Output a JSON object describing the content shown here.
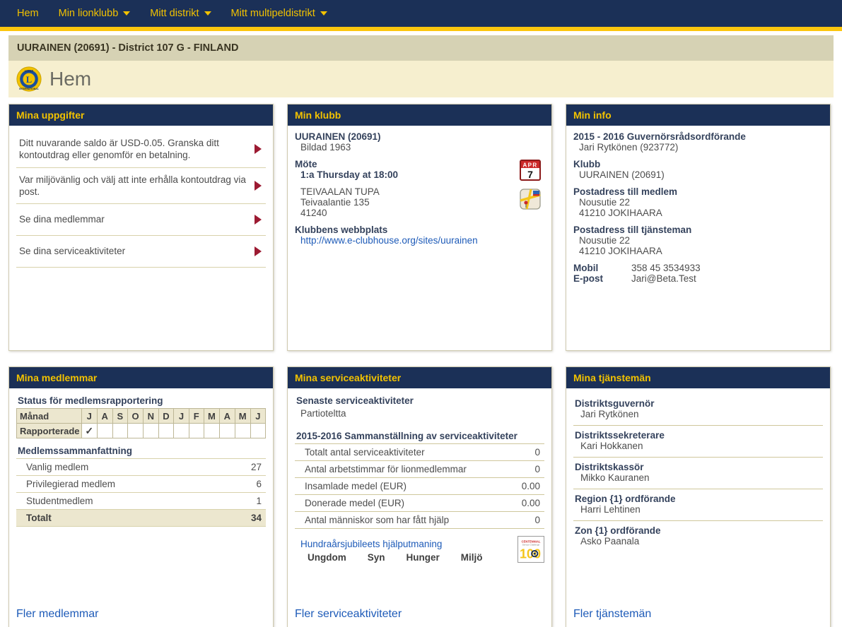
{
  "nav": {
    "items": [
      {
        "label": "Hem",
        "has_caret": false
      },
      {
        "label": "Min lionklubb",
        "has_caret": true
      },
      {
        "label": "Mitt distrikt",
        "has_caret": true
      },
      {
        "label": "Mitt multipeldistrikt",
        "has_caret": true
      }
    ]
  },
  "breadcrumb": "UURAINEN (20691) - District 107 G - FINLAND",
  "page_title": "Hem",
  "colors": {
    "nav_bg": "#1b3057",
    "nav_text": "#f2c200",
    "nav_stripe": "#fcc60e",
    "crumb_bg": "#d6d2b4",
    "title_bg": "#f6efcf",
    "link": "#1e5bb8",
    "arrow_red": "#9c1a32",
    "check_green": "#1f7a1f"
  },
  "my_details": {
    "title": "Mina uppgifter",
    "rows": [
      "Ditt nuvarande saldo är USD-0.05. Granska ditt kontoutdrag eller genomför en betalning.",
      "Var miljövänlig och välj att inte erhålla kontoutdrag via post.",
      "Se dina medlemmar",
      "Se dina serviceaktiviteter"
    ]
  },
  "my_club": {
    "title": "Min klubb",
    "club_name": "UURAINEN (20691)",
    "founded": "Bildad 1963",
    "meeting_label": "Möte",
    "meeting_when": "1:a Thursday at 18:00",
    "venue": "TEIVAALAN TUPA",
    "street": "Teivaalantie 135",
    "postal": "41240",
    "website_label": "Klubbens webbplats",
    "website_url": "http://www.e-clubhouse.org/sites/uurainen",
    "calendar_icon": {
      "month": "APR",
      "day": "7"
    }
  },
  "my_info": {
    "title": "Min info",
    "role_title": "2015 - 2016 Guvernörsrådsordförande",
    "role_person": "Jari Rytkönen (923772)",
    "club_label": "Klubb",
    "club_value": "UURAINEN (20691)",
    "member_address_label": "Postadress till medlem",
    "member_address": [
      "Nousutie 22",
      "41210 JOKIHAARA"
    ],
    "officer_address_label": "Postadress till tjänsteman",
    "officer_address": [
      "Nousutie 22",
      "41210 JOKIHAARA"
    ],
    "mobile_label": "Mobil",
    "mobile_value": "358 45 3534933",
    "email_label": "E-post",
    "email_value": "Jari@Beta.Test"
  },
  "my_members": {
    "title": "Mina medlemmar",
    "report_status_title": "Status för medlemsrapportering",
    "month_header_label": "Månad",
    "reported_label": "Rapporterade",
    "months": [
      "J",
      "A",
      "S",
      "O",
      "N",
      "D",
      "J",
      "F",
      "M",
      "A",
      "M",
      "J"
    ],
    "reported": [
      "✓",
      "",
      "",
      "",
      "",
      "",
      "",
      "",
      "",
      "",
      "",
      ""
    ],
    "summary_title": "Medlemssammanfattning",
    "summary_rows": [
      {
        "label": "Vanlig medlem",
        "value": "27"
      },
      {
        "label": "Privilegierad medlem",
        "value": "6"
      },
      {
        "label": "Studentmedlem",
        "value": "1"
      }
    ],
    "total_label": "Totalt",
    "total_value": "34",
    "more_link": "Fler medlemmar"
  },
  "my_service": {
    "title": "Mina serviceaktiviteter",
    "latest_title": "Senaste serviceaktiviteter",
    "latest_item": "Partioteltta",
    "summary_title": "2015-2016 Sammanställning av serviceaktiviteter",
    "summary_rows": [
      {
        "label": "Totalt antal serviceaktiviteter",
        "value": "0"
      },
      {
        "label": "Antal arbetstimmar för lionmedlemmar",
        "value": "0"
      },
      {
        "label": "Insamlade medel (EUR)",
        "value": "0.00"
      },
      {
        "label": "Donerade medel (EUR)",
        "value": "0.00"
      },
      {
        "label": "Antal människor som har fått hjälp",
        "value": "0"
      }
    ],
    "centennial_link": "Hundraårsjubileets hjälputmaning",
    "centennial_categories": [
      "Ungdom",
      "Syn",
      "Hunger",
      "Miljö"
    ],
    "centennial_badge_text": "100",
    "centennial_badge_caption": "CENTENNIAL",
    "more_link": "Fler serviceaktiviteter"
  },
  "my_officers": {
    "title": "Mina tjänstemän",
    "officers": [
      {
        "role": "Distriktsguvernör",
        "name": "Jari Rytkönen"
      },
      {
        "role": "Distriktssekreterare",
        "name": "Kari Hokkanen"
      },
      {
        "role": "Distriktskassör",
        "name": "Mikko Kauranen"
      },
      {
        "role": "Region {1} ordförande",
        "name": "Harri Lehtinen"
      },
      {
        "role": "Zon {1} ordförande",
        "name": "Asko Paanala"
      }
    ],
    "more_link": "Fler tjänstemän"
  }
}
